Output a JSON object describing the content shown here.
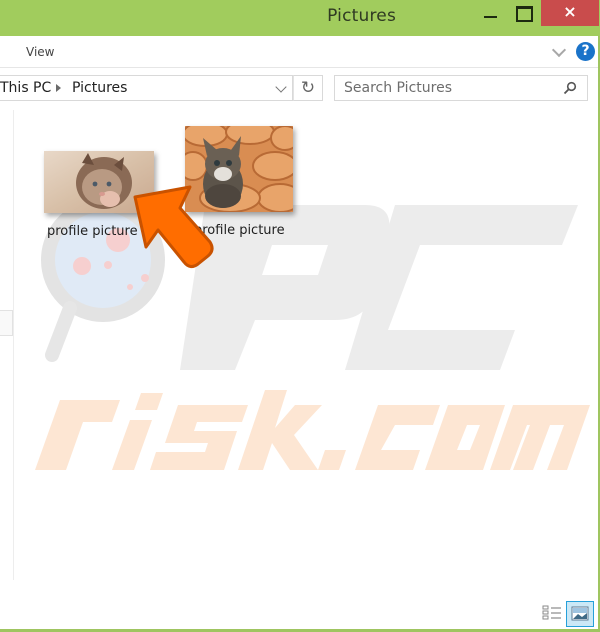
{
  "window": {
    "title": "Pictures",
    "accent_color": "#a1cc5d",
    "close_color": "#c94c4c",
    "controls": {
      "minimize": "minimize",
      "maximize": "maximize",
      "close": "×"
    }
  },
  "ribbon": {
    "tabs": [
      {
        "label": "View"
      }
    ],
    "expand_icon": "chevron-down-icon",
    "help_label": "?"
  },
  "address_bar": {
    "segments": [
      {
        "label": "This PC"
      },
      {
        "label": "Pictures"
      }
    ],
    "separator_icon": "triangle-right-icon",
    "dropdown_icon": "chevron-down-icon",
    "refresh_label": "↻"
  },
  "search": {
    "placeholder": "Search Pictures",
    "value": ""
  },
  "files": [
    {
      "name": "profile picture",
      "thumbnail": "fluffy kitten lying on blanket"
    },
    {
      "name": "profile picture",
      "thumbnail": "tabby kitten in clay pots"
    }
  ],
  "annotation": {
    "type": "arrow",
    "color": "#ff6a00",
    "points_to": "first file"
  },
  "watermark": {
    "top_text": "PC",
    "bottom_text": "risk.com"
  },
  "status_bar": {
    "views": [
      {
        "name": "details-view",
        "active": false
      },
      {
        "name": "large-icons-view",
        "active": true
      }
    ]
  }
}
